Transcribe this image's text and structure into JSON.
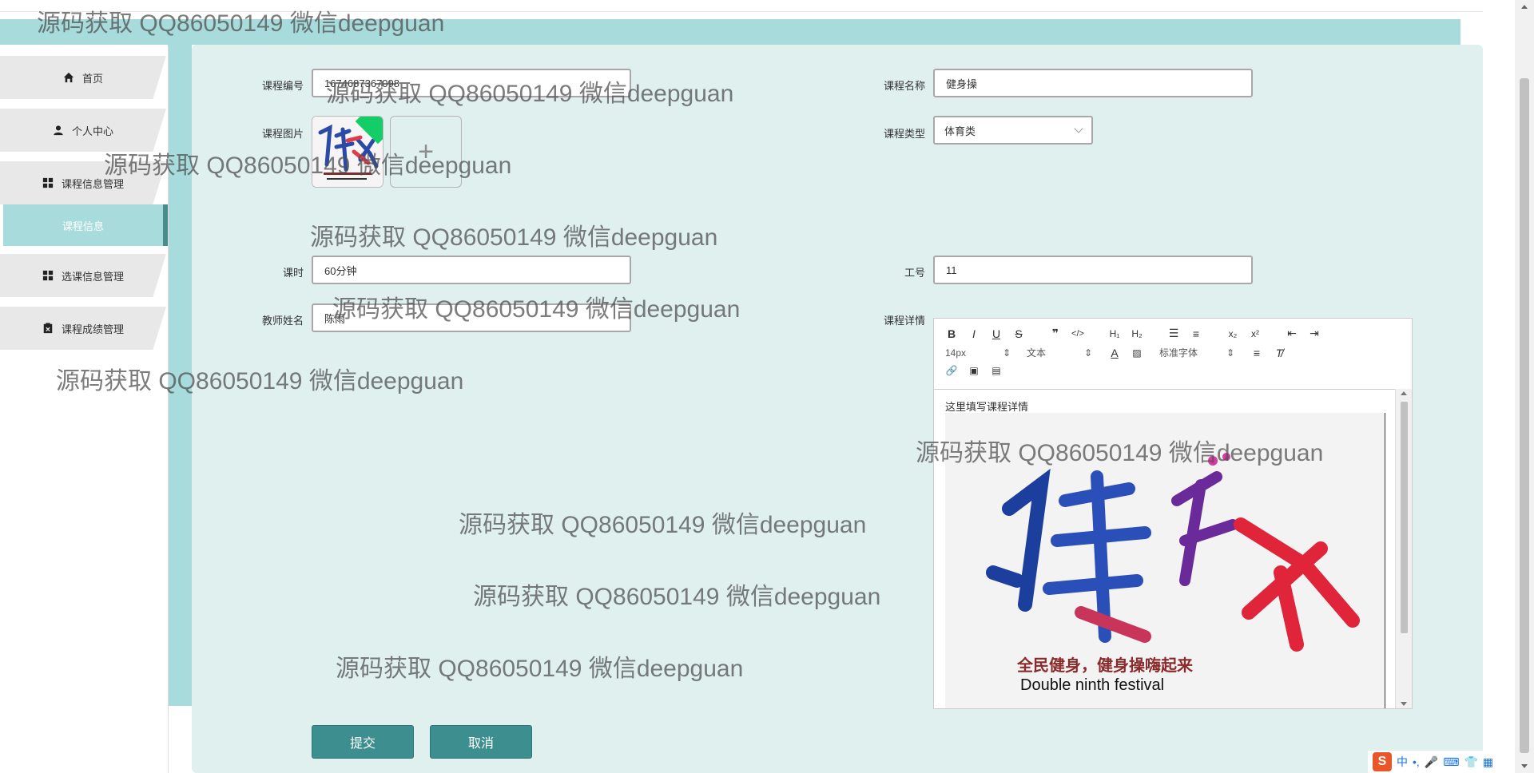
{
  "sidebar": {
    "items": [
      {
        "label": "首页",
        "icon": "home-icon"
      },
      {
        "label": "个人中心",
        "icon": "user-icon"
      },
      {
        "label": "课程信息管理",
        "icon": "grid-icon"
      },
      {
        "label": "课程信息",
        "icon": ""
      },
      {
        "label": "选课信息管理",
        "icon": "grid-icon"
      },
      {
        "label": "课程成绩管理",
        "icon": "clipboard-icon"
      }
    ]
  },
  "form": {
    "course_code_label": "课程编号",
    "course_code_value": "1674687367098",
    "course_name_label": "课程名称",
    "course_name_value": "健身操",
    "course_image_label": "课程图片",
    "course_type_label": "课程类型",
    "course_type_value": "体育类",
    "hours_label": "课时",
    "hours_value": "60分钟",
    "staff_no_label": "工号",
    "staff_no_value": "11",
    "teacher_label": "教师姓名",
    "teacher_value": "陈雨",
    "detail_label": "课程详情",
    "upload_plus": "+"
  },
  "editor": {
    "font_size": "14px",
    "block_type": "文本",
    "font_family": "标准字体",
    "placeholder_text": "这里填写课程详情",
    "image_title": "健身操",
    "image_slogan": "全民健身，健身操嗨起来",
    "image_caption": "Double ninth festival"
  },
  "buttons": {
    "submit": "提交",
    "cancel": "取消"
  },
  "watermark": {
    "text": "源码获取 QQ86050149 微信deepguan"
  },
  "ime": {
    "logo": "S",
    "lang": "中",
    "punct": "•,"
  },
  "colors": {
    "accent": "#a8dcdc",
    "panel": "#dff0ef",
    "button": "#3d8f8f"
  }
}
